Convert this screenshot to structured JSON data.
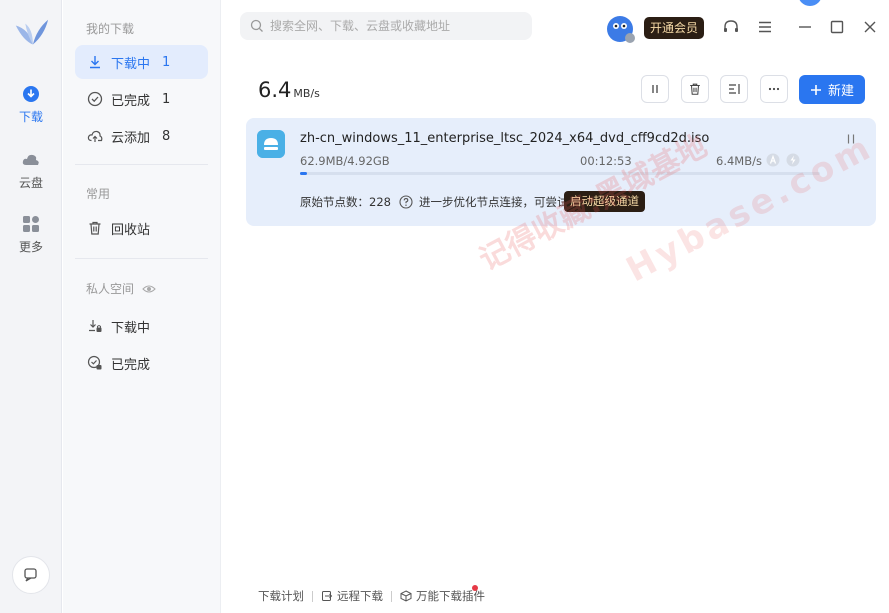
{
  "app": {
    "accent": "#2a76f0",
    "rail": [
      {
        "label": "下载",
        "icon": "download-circle-icon"
      },
      {
        "label": "云盘",
        "icon": "cloud-icon"
      },
      {
        "label": "更多",
        "icon": "apps-grid-icon"
      }
    ]
  },
  "sidebar": {
    "section_downloads": "我的下载",
    "downloading": {
      "label": "下载中",
      "count": "1"
    },
    "completed": {
      "label": "已完成",
      "count": "1"
    },
    "cloud_added": {
      "label": "云添加",
      "count": "8"
    },
    "section_common": "常用",
    "recycle_bin": "回收站",
    "section_private": "私人空间",
    "private_downloading": "下载中",
    "private_completed": "已完成"
  },
  "topbar": {
    "search_placeholder": "搜索全网、下载、云盘或收藏地址",
    "vip_label": "开通会员"
  },
  "main": {
    "speed_value": "6.4",
    "speed_unit": "MB/s",
    "new_button": "新建"
  },
  "task": {
    "filename": "zh-cn_windows_11_enterprise_ltsc_2024_x64_dvd_cff9cd2d.iso",
    "size_progress": "62.9MB/4.92GB",
    "time_remaining": "00:12:53",
    "speed": "6.4MB/s",
    "progress_fraction": 0.0128,
    "nodes_label": "原始节点数：228",
    "hint": "进一步优化节点连接，可尝试",
    "turbo_button": "启动超级通道"
  },
  "footer": {
    "plan": "下载计划",
    "remote": "远程下载",
    "plugin": "万能下载插件"
  },
  "watermark": {
    "text_cn": "记得收藏:黑域基地",
    "text_en": "Hybase.com"
  }
}
